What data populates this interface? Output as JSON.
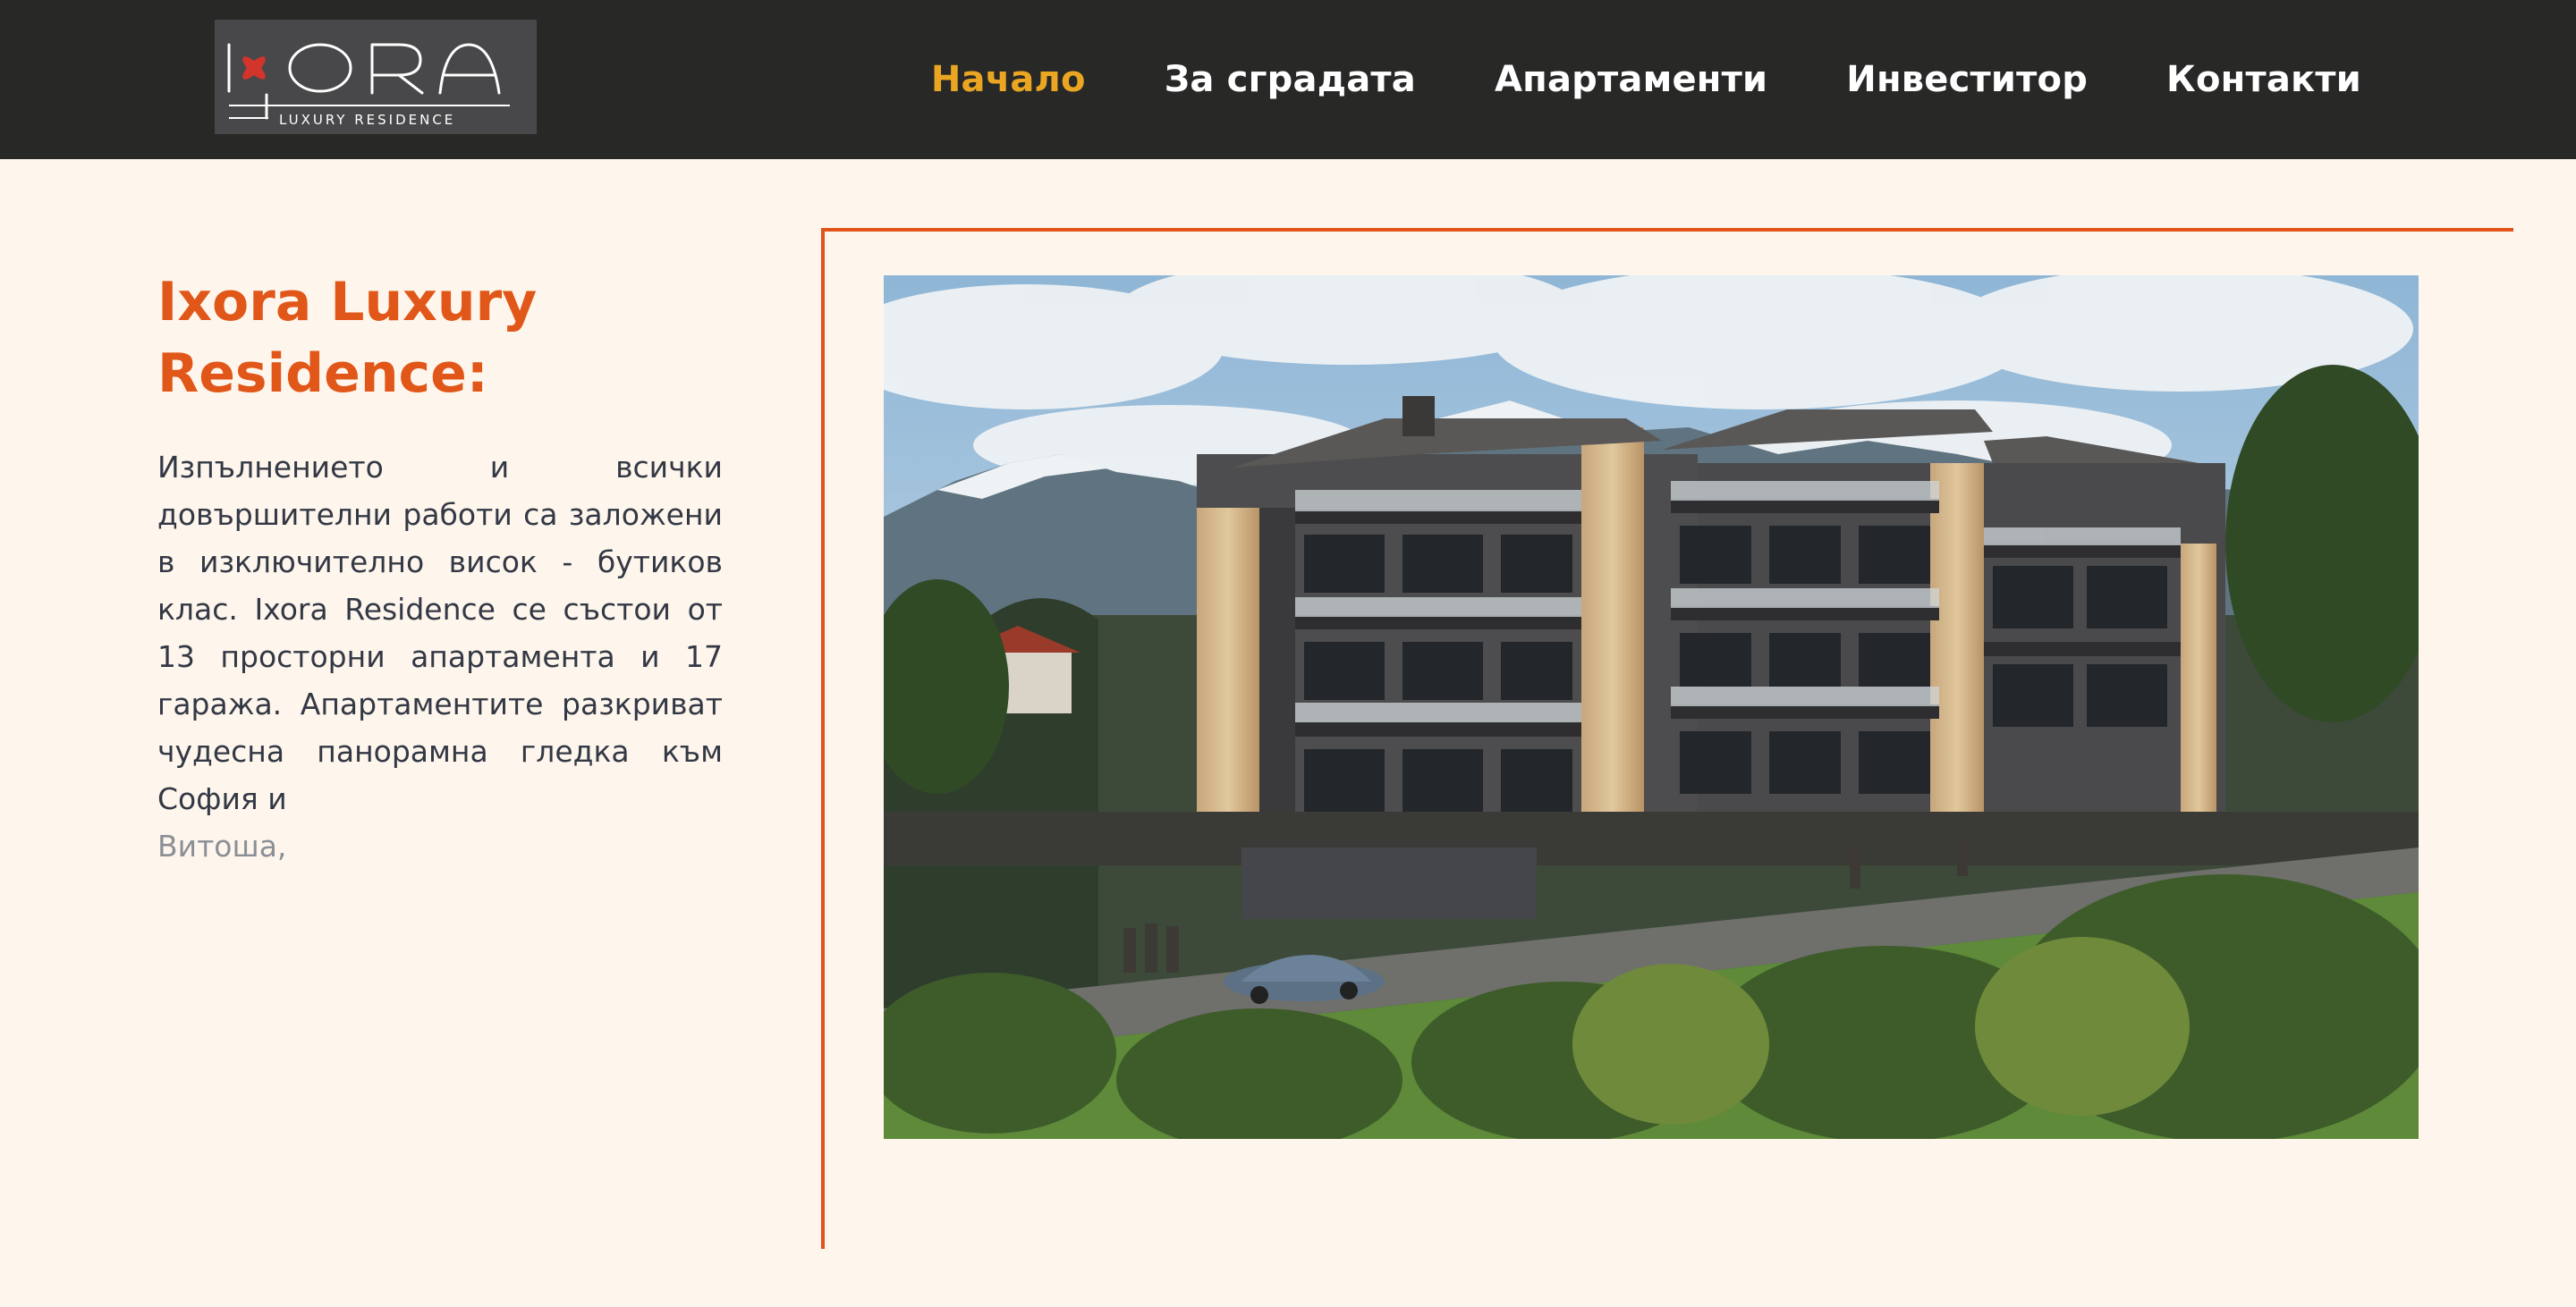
{
  "header": {
    "logo": {
      "brand": "IXORA",
      "tagline": "LUXURY RESIDENCE",
      "icon": "ixora-flower-logo"
    },
    "nav": [
      {
        "label": "Начало",
        "active": true
      },
      {
        "label": "За сградата",
        "active": false
      },
      {
        "label": "Апартаменти",
        "active": false
      },
      {
        "label": "Инвеститор",
        "active": false
      },
      {
        "label": "Контакти",
        "active": false
      }
    ]
  },
  "intro": {
    "title": "Ixora Luxury Residence:",
    "body": "Изпълнението и всички довършителни работи са заложени в изключително висок - бутиков клас. Ixora Residence се състои от 13 просторни апартамента и 17 гаража. Апартаментите разкриват чудесна панорамна гледка към София и",
    "body_faded": "Витоша,"
  },
  "colors": {
    "accent": "#e15719",
    "nav_active": "#eaa622",
    "header_bg": "#282827",
    "page_bg": "#fef6ec"
  }
}
